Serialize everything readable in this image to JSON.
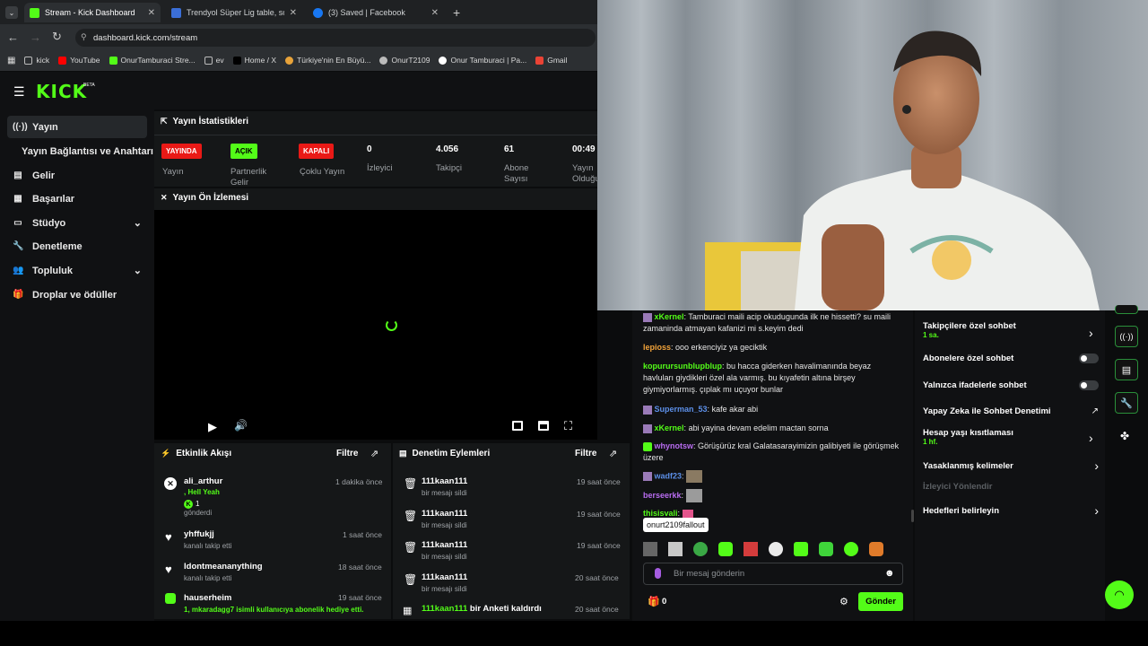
{
  "tabs": [
    {
      "label": "Stream - Kick Dashboard",
      "color": "#53fc18"
    },
    {
      "label": "Trendyol Süper Lig table, sched",
      "color": "#3b6fd8"
    },
    {
      "label": "(3) Saved | Facebook",
      "color": "#1877f2"
    }
  ],
  "address": {
    "url": "dashboard.kick.com/stream"
  },
  "bookmarks": [
    "kick",
    "YouTube",
    "OnurTamburaci Stre...",
    "ev",
    "Home / X",
    "Türkiye'nin En Büyü...",
    "OnurT2109",
    "Onur Tamburaci | Pa...",
    "Gmail"
  ],
  "brand": {
    "logo": "KICK",
    "beta": "BETA"
  },
  "sidebar": {
    "items": [
      {
        "label": "Yayın"
      },
      {
        "label": "Yayın Bağlantısı ve Anahtarı"
      },
      {
        "label": "Gelir"
      },
      {
        "label": "Başarılar"
      },
      {
        "label": "Stüdyo"
      },
      {
        "label": "Denetleme"
      },
      {
        "label": "Topluluk"
      },
      {
        "label": "Droplar ve ödüller"
      }
    ]
  },
  "stats": {
    "title": "Yayın İstatistikleri",
    "items": [
      {
        "badge": "YAYINDA",
        "label": "Yayın"
      },
      {
        "badge": "AÇIK",
        "label": "Partnerlik Gelir"
      },
      {
        "badge": "KAPALI",
        "label": "Çoklu Yayın"
      },
      {
        "value": "0",
        "label": "İzleyici"
      },
      {
        "value": "4.056",
        "label": "Takipçi"
      },
      {
        "value": "61",
        "label": "Abone Sayısı"
      },
      {
        "value": "00:49",
        "label": "Yayın Olduğu"
      }
    ]
  },
  "preview": {
    "title": "Yayın Ön İzlemesi"
  },
  "activity": {
    "title": "Etkinlik Akışı",
    "filter": "Filtre",
    "items": [
      {
        "user": "ali_arthur",
        "line1": ", Hell Yeah",
        "line2": "1",
        "line3": "gönderdi",
        "time": "1 dakika önce"
      },
      {
        "user": "yhffukjj",
        "line1": "kanalı takip etti",
        "time": "1 saat önce"
      },
      {
        "user": "Idontmeananything",
        "line1": "kanalı takip etti",
        "time": "18 saat önce"
      },
      {
        "user": "hauserheim",
        "line1": "1, mkaradagg7 isimli kullanıcıya abonelik hediye etti.",
        "time": "19 saat önce"
      }
    ]
  },
  "moderation": {
    "title": "Denetim Eylemleri",
    "filter": "Filtre",
    "items": [
      {
        "user": "111kaan111",
        "action": "bir mesajı sildi",
        "time": "19 saat önce"
      },
      {
        "user": "111kaan111",
        "action": "bir mesajı sildi",
        "time": "19 saat önce"
      },
      {
        "user": "111kaan111",
        "action": "bir mesajı sildi",
        "time": "19 saat önce"
      },
      {
        "user": "111kaan111",
        "action": "bir mesajı sildi",
        "time": "20 saat önce"
      },
      {
        "user": "111kaan111",
        "action": "bir Anketi kaldırdı",
        "time": "20 saat önce"
      }
    ]
  },
  "chat": {
    "messages": [
      {
        "user": "xKernel",
        "color": "#53fc18",
        "text": "Tamburaci maili acip okudugunda ilk ne hissetti? su maili zamaninda atmayan kafanizi mi s.keyim dedi"
      },
      {
        "user": "lepioss",
        "color": "#f2a33a",
        "text": "ooo erkenciyiz ya geciktik"
      },
      {
        "user": "kopurursunblupblup",
        "color": "#53fc18",
        "text": "bu hacca giderken havalimanında beyaz havluları giydikleri özel ala varmış. bu kıyafetin altına birşey giymiyorlarmış. çıplak mı uçuyor bunlar"
      },
      {
        "user": "Superman_53",
        "color": "#5c8fe8",
        "text": "kafe akar abi"
      },
      {
        "user": "xKernel",
        "color": "#53fc18",
        "text": "abi yayina devam edelim mactan sorna"
      },
      {
        "user": "whynotsw",
        "color": "#b86cf0",
        "text": "Görüşürüz kral Galatasarayimizin galibiyeti ile görüşmek üzere"
      },
      {
        "user": "wadf23",
        "color": "#5c8fe8",
        "text": ""
      },
      {
        "user": "berseerkk",
        "color": "#b86cf0",
        "text": ""
      },
      {
        "user": "thisisvali",
        "color": "#53fc18",
        "text": ""
      }
    ],
    "tooltip": "onurt2109fallout",
    "input_placeholder": "Bir mesaj gönderin",
    "count": "0",
    "send": "Gönder"
  },
  "chat_settings": {
    "rows": [
      {
        "label": "Takipçilere özel sohbet",
        "sub": "1 sa."
      },
      {
        "label": "Abonelere özel sohbet"
      },
      {
        "label": "Yalnızca ifadelerle sohbet"
      },
      {
        "label": "Yapay Zeka ile Sohbet Denetimi"
      },
      {
        "label": "Hesap yaşı kısıtlaması",
        "sub": "1 hf."
      },
      {
        "label": "Yasaklanmış kelimeler"
      },
      {
        "label": "İzleyici Yönlendir"
      },
      {
        "label": "Hedefleri belirleyin"
      }
    ]
  },
  "colors": {
    "accent": "#53fc18",
    "live": "#e91916"
  }
}
